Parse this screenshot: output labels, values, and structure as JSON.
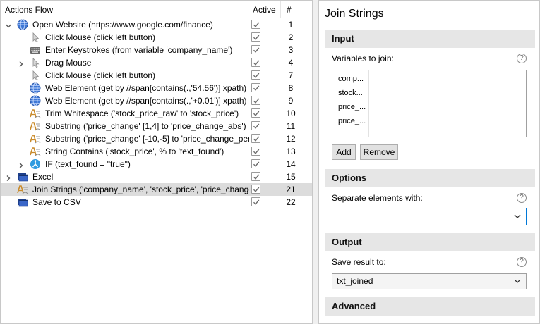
{
  "flow": {
    "header": {
      "col_name": "Actions Flow",
      "col_active": "Active",
      "col_num": "#"
    },
    "rows": [
      {
        "label": "Open Website (https://www.google.com/finance)",
        "num": "1",
        "icon": "globe-icon",
        "indent": 0,
        "arrow": "expanded"
      },
      {
        "label": "Click Mouse (click left button)",
        "num": "2",
        "icon": "mouse-icon",
        "indent": 1,
        "arrow": ""
      },
      {
        "label": "Enter Keystrokes (from variable 'company_name')",
        "num": "3",
        "icon": "keyboard-icon",
        "indent": 1,
        "arrow": ""
      },
      {
        "label": "Drag Mouse",
        "num": "4",
        "icon": "mouse-icon",
        "indent": 1,
        "arrow": "collapsed"
      },
      {
        "label": "Click Mouse (click left button)",
        "num": "7",
        "icon": "mouse-icon",
        "indent": 1,
        "arrow": ""
      },
      {
        "label": "Web Element (get by //span[contains(.,'54.56')] xpath)",
        "num": "8",
        "icon": "globe-icon",
        "indent": 1,
        "arrow": ""
      },
      {
        "label": "Web Element (get by //span[contains(.,'+0.01')] xpath)",
        "num": "9",
        "icon": "globe-icon",
        "indent": 1,
        "arrow": ""
      },
      {
        "label": "Trim Whitespace ('stock_price_raw' to 'stock_price')",
        "num": "10",
        "icon": "text-abc-icon",
        "indent": 1,
        "arrow": ""
      },
      {
        "label": "Substring ('price_change' [1,4] to 'price_change_abs')",
        "num": "11",
        "icon": "text-abc-icon",
        "indent": 1,
        "arrow": ""
      },
      {
        "label": "Substring ('price_change' [-10,-5] to 'price_change_per",
        "num": "12",
        "icon": "text-abc-icon",
        "indent": 1,
        "arrow": ""
      },
      {
        "label": "String Contains ('stock_price', % to 'text_found')",
        "num": "13",
        "icon": "text-abc-icon",
        "indent": 1,
        "arrow": ""
      },
      {
        "label": "IF (text_found = \"true\")",
        "num": "14",
        "icon": "branch-icon",
        "indent": 1,
        "arrow": "collapsed"
      },
      {
        "label": "Excel",
        "num": "15",
        "icon": "window-icon",
        "indent": 0,
        "arrow": "collapsed"
      },
      {
        "label": "Join Strings ('company_name', 'stock_price', 'price_change",
        "num": "21",
        "icon": "text-abc-icon",
        "indent": 0,
        "arrow": "",
        "selected": true
      },
      {
        "label": "Save to CSV",
        "num": "22",
        "icon": "window-icon",
        "indent": 0,
        "arrow": ""
      }
    ]
  },
  "props": {
    "title": "Join Strings",
    "input": {
      "heading": "Input",
      "variables_label": "Variables to join:",
      "variables": [
        "comp...",
        "stock...",
        "price_...",
        "price_..."
      ],
      "add_label": "Add",
      "remove_label": "Remove"
    },
    "options": {
      "heading": "Options",
      "separator_label": "Separate elements with:",
      "separator_value": ""
    },
    "output": {
      "heading": "Output",
      "save_label": "Save result to:",
      "save_value": "txt_joined"
    },
    "advanced": {
      "heading": "Advanced"
    },
    "help_glyph": "?"
  },
  "colors": {
    "selection": "#dcdcdc",
    "section_bg": "#e6e6e6",
    "focus": "#0078d7"
  }
}
